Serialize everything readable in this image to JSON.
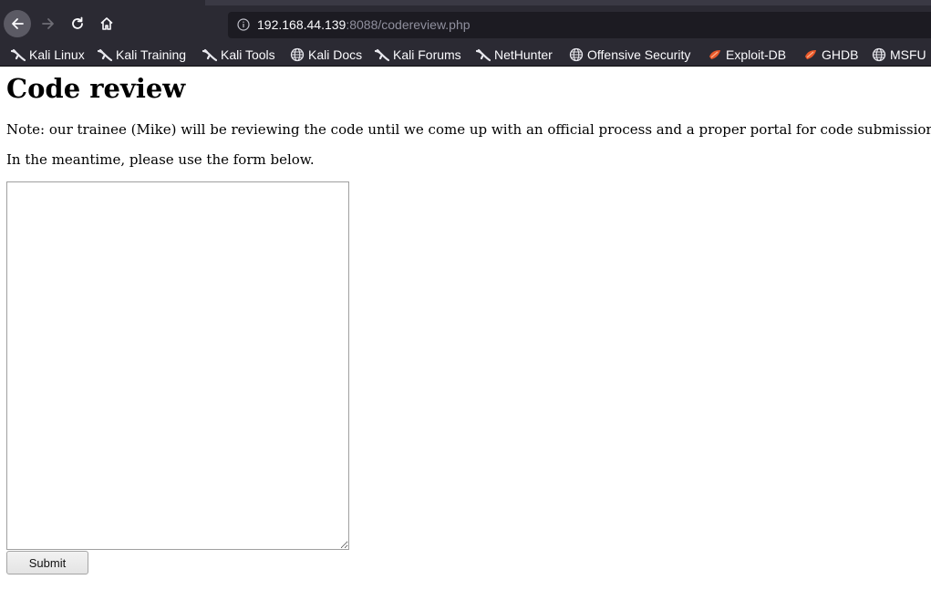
{
  "browser": {
    "url_host": "192.168.44.139",
    "url_rest": ":8088/codereview.php",
    "nav": {
      "back_icon": "arrow-left-icon",
      "forward_icon": "arrow-right-icon",
      "reload_icon": "reload-icon",
      "home_icon": "home-icon"
    },
    "bookmarks": [
      {
        "label": "Kali Linux",
        "icon": "kali-dragon-icon"
      },
      {
        "label": "Kali Training",
        "icon": "kali-dragon-icon"
      },
      {
        "label": "Kali Tools",
        "icon": "kali-dragon-icon"
      },
      {
        "label": "Kali Docs",
        "icon": "globe-icon"
      },
      {
        "label": "Kali Forums",
        "icon": "kali-dragon-icon"
      },
      {
        "label": "NetHunter",
        "icon": "kali-dragon-icon"
      },
      {
        "label": "Offensive Security",
        "icon": "globe-icon"
      },
      {
        "label": "Exploit-DB",
        "icon": "exploit-db-icon"
      },
      {
        "label": "GHDB",
        "icon": "exploit-db-icon"
      },
      {
        "label": "MSFU",
        "icon": "globe-icon"
      }
    ]
  },
  "page": {
    "title": "Code review",
    "note": "Note: our trainee (Mike) will be reviewing the code until we come up with an official process and a proper portal for code submission.",
    "hint": "In the meantime, please use the form below.",
    "form": {
      "textarea_value": "",
      "submit_label": "Submit"
    }
  }
}
